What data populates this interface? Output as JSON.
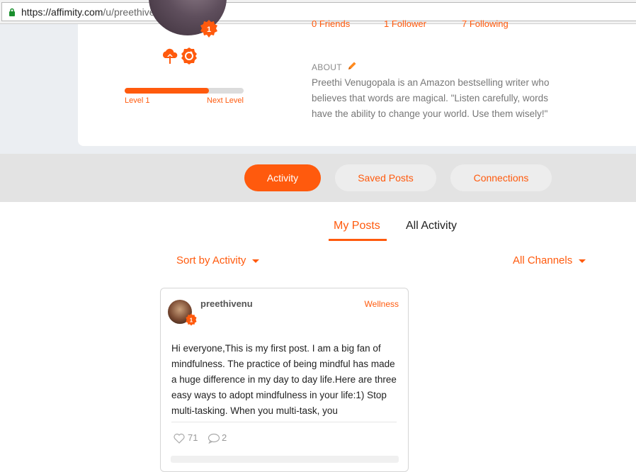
{
  "browser": {
    "url_domain": "https://affimity.com",
    "url_path": "/u/preethivenu"
  },
  "profile": {
    "level_number": "1",
    "stats": {
      "friends": "0 Friends",
      "followers": "1 Follower",
      "following": "7 Following"
    },
    "progress": {
      "fraction": 0.71,
      "level_label": "Level 1",
      "next_label": "Next Level"
    },
    "about_heading": "ABOUT",
    "about_text": "Preethi Venugopala is an Amazon bestselling writer who believes that words are magical. \"Listen carefully, words have the ability to change your world. Use them wisely!\"",
    "icons": [
      "upload-cloud-icon",
      "refresh-badge-icon"
    ]
  },
  "tabs": [
    {
      "label": "Activity",
      "active": true
    },
    {
      "label": "Saved Posts",
      "active": false
    },
    {
      "label": "Connections",
      "active": false
    }
  ],
  "subtabs": [
    {
      "label": "My Posts",
      "active": true
    },
    {
      "label": "All Activity",
      "active": false
    }
  ],
  "filters": {
    "sort_label": "Sort by Activity",
    "channel_label": "All Channels"
  },
  "post": {
    "username": "preethivenu",
    "level_number": "1",
    "channel": "Wellness",
    "body": "Hi everyone,This is my first post. I am a big fan of mindfulness. The practice of being mindful has made a huge difference in my day to day life.Here are three easy ways to adopt mindfulness in your life:1) Stop multi-tasking. When you multi-task, you",
    "likes": "71",
    "comments": "2"
  },
  "colors": {
    "accent": "#ff5a0d",
    "tabstrip_bg": "#e3e3e3",
    "page_bg": "#ebeef2"
  }
}
